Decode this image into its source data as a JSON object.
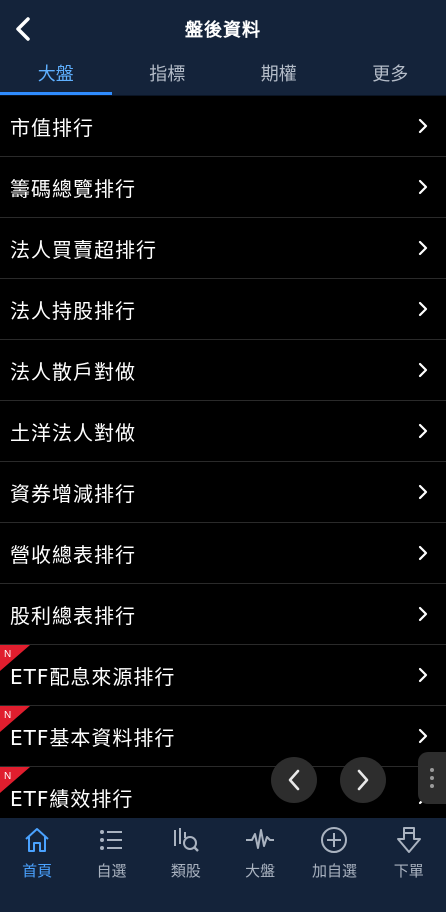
{
  "header": {
    "title": "盤後資料",
    "back_icon": "back-arrow-icon"
  },
  "tabs": [
    {
      "label": "大盤",
      "active": true
    },
    {
      "label": "指標",
      "active": false
    },
    {
      "label": "期權",
      "active": false
    },
    {
      "label": "更多",
      "active": false
    }
  ],
  "list": [
    {
      "label": "市值排行",
      "new": false
    },
    {
      "label": "籌碼總覽排行",
      "new": false
    },
    {
      "label": "法人買賣超排行",
      "new": false
    },
    {
      "label": "法人持股排行",
      "new": false
    },
    {
      "label": "法人散戶對做",
      "new": false
    },
    {
      "label": "土洋法人對做",
      "new": false
    },
    {
      "label": "資券增減排行",
      "new": false
    },
    {
      "label": "營收總表排行",
      "new": false
    },
    {
      "label": "股利總表排行",
      "new": false
    },
    {
      "label": "ETF配息來源排行",
      "new": true
    },
    {
      "label": "ETF基本資料排行",
      "new": true
    },
    {
      "label": "ETF績效排行",
      "new": true
    }
  ],
  "badge_text": "N",
  "bottom_nav": [
    {
      "label": "首頁",
      "icon": "home-icon",
      "active": true
    },
    {
      "label": "自選",
      "icon": "list-icon",
      "active": false
    },
    {
      "label": "類股",
      "icon": "sector-search-icon",
      "active": false
    },
    {
      "label": "大盤",
      "icon": "pulse-icon",
      "active": false
    },
    {
      "label": "加自選",
      "icon": "plus-circle-icon",
      "active": false
    },
    {
      "label": "下單",
      "icon": "order-down-icon",
      "active": false
    }
  ],
  "colors": {
    "bar": "#14233a",
    "accent": "#2f8cff",
    "badge": "#e01e2e"
  }
}
